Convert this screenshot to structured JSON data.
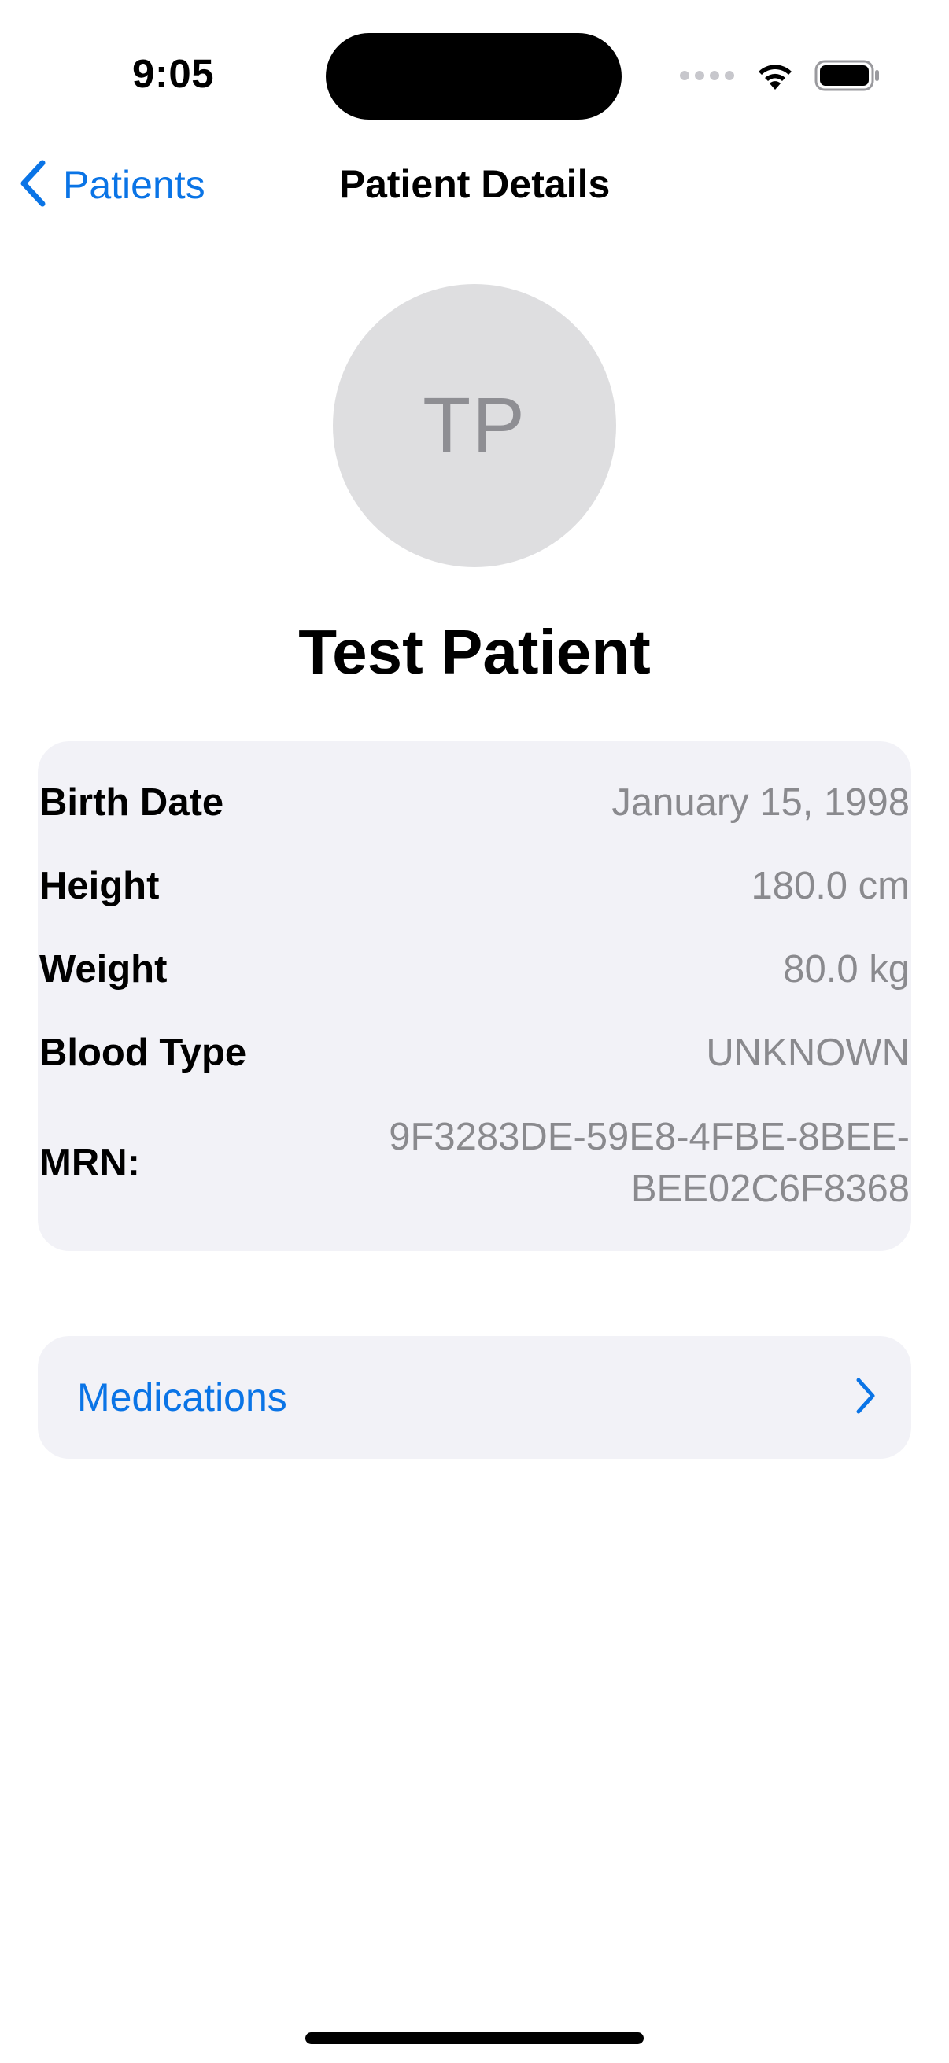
{
  "status_bar": {
    "time": "9:05"
  },
  "nav": {
    "back_label": "Patients",
    "title": "Patient Details"
  },
  "patient": {
    "initials": "TP",
    "name": "Test Patient"
  },
  "details": {
    "birth_date": {
      "label": "Birth Date",
      "value": "January 15, 1998"
    },
    "height": {
      "label": "Height",
      "value": "180.0 cm"
    },
    "weight": {
      "label": "Weight",
      "value": "80.0 kg"
    },
    "blood_type": {
      "label": "Blood Type",
      "value": "UNKNOWN"
    },
    "mrn": {
      "label": "MRN:",
      "value": "9F3283DE-59E8-4FBE-8BEE-BEE02C6F8368"
    }
  },
  "medications": {
    "label": "Medications"
  },
  "colors": {
    "accent": "#0a74e6",
    "card_background": "#f2f2f7",
    "secondary_text": "#8a8a8e",
    "avatar_background": "#dedee0"
  },
  "icons": {
    "back": "chevron-left-icon",
    "disclosure": "chevron-right-icon",
    "wifi": "wifi-icon",
    "battery": "battery-icon",
    "signal": "cellular-signal-icon"
  }
}
